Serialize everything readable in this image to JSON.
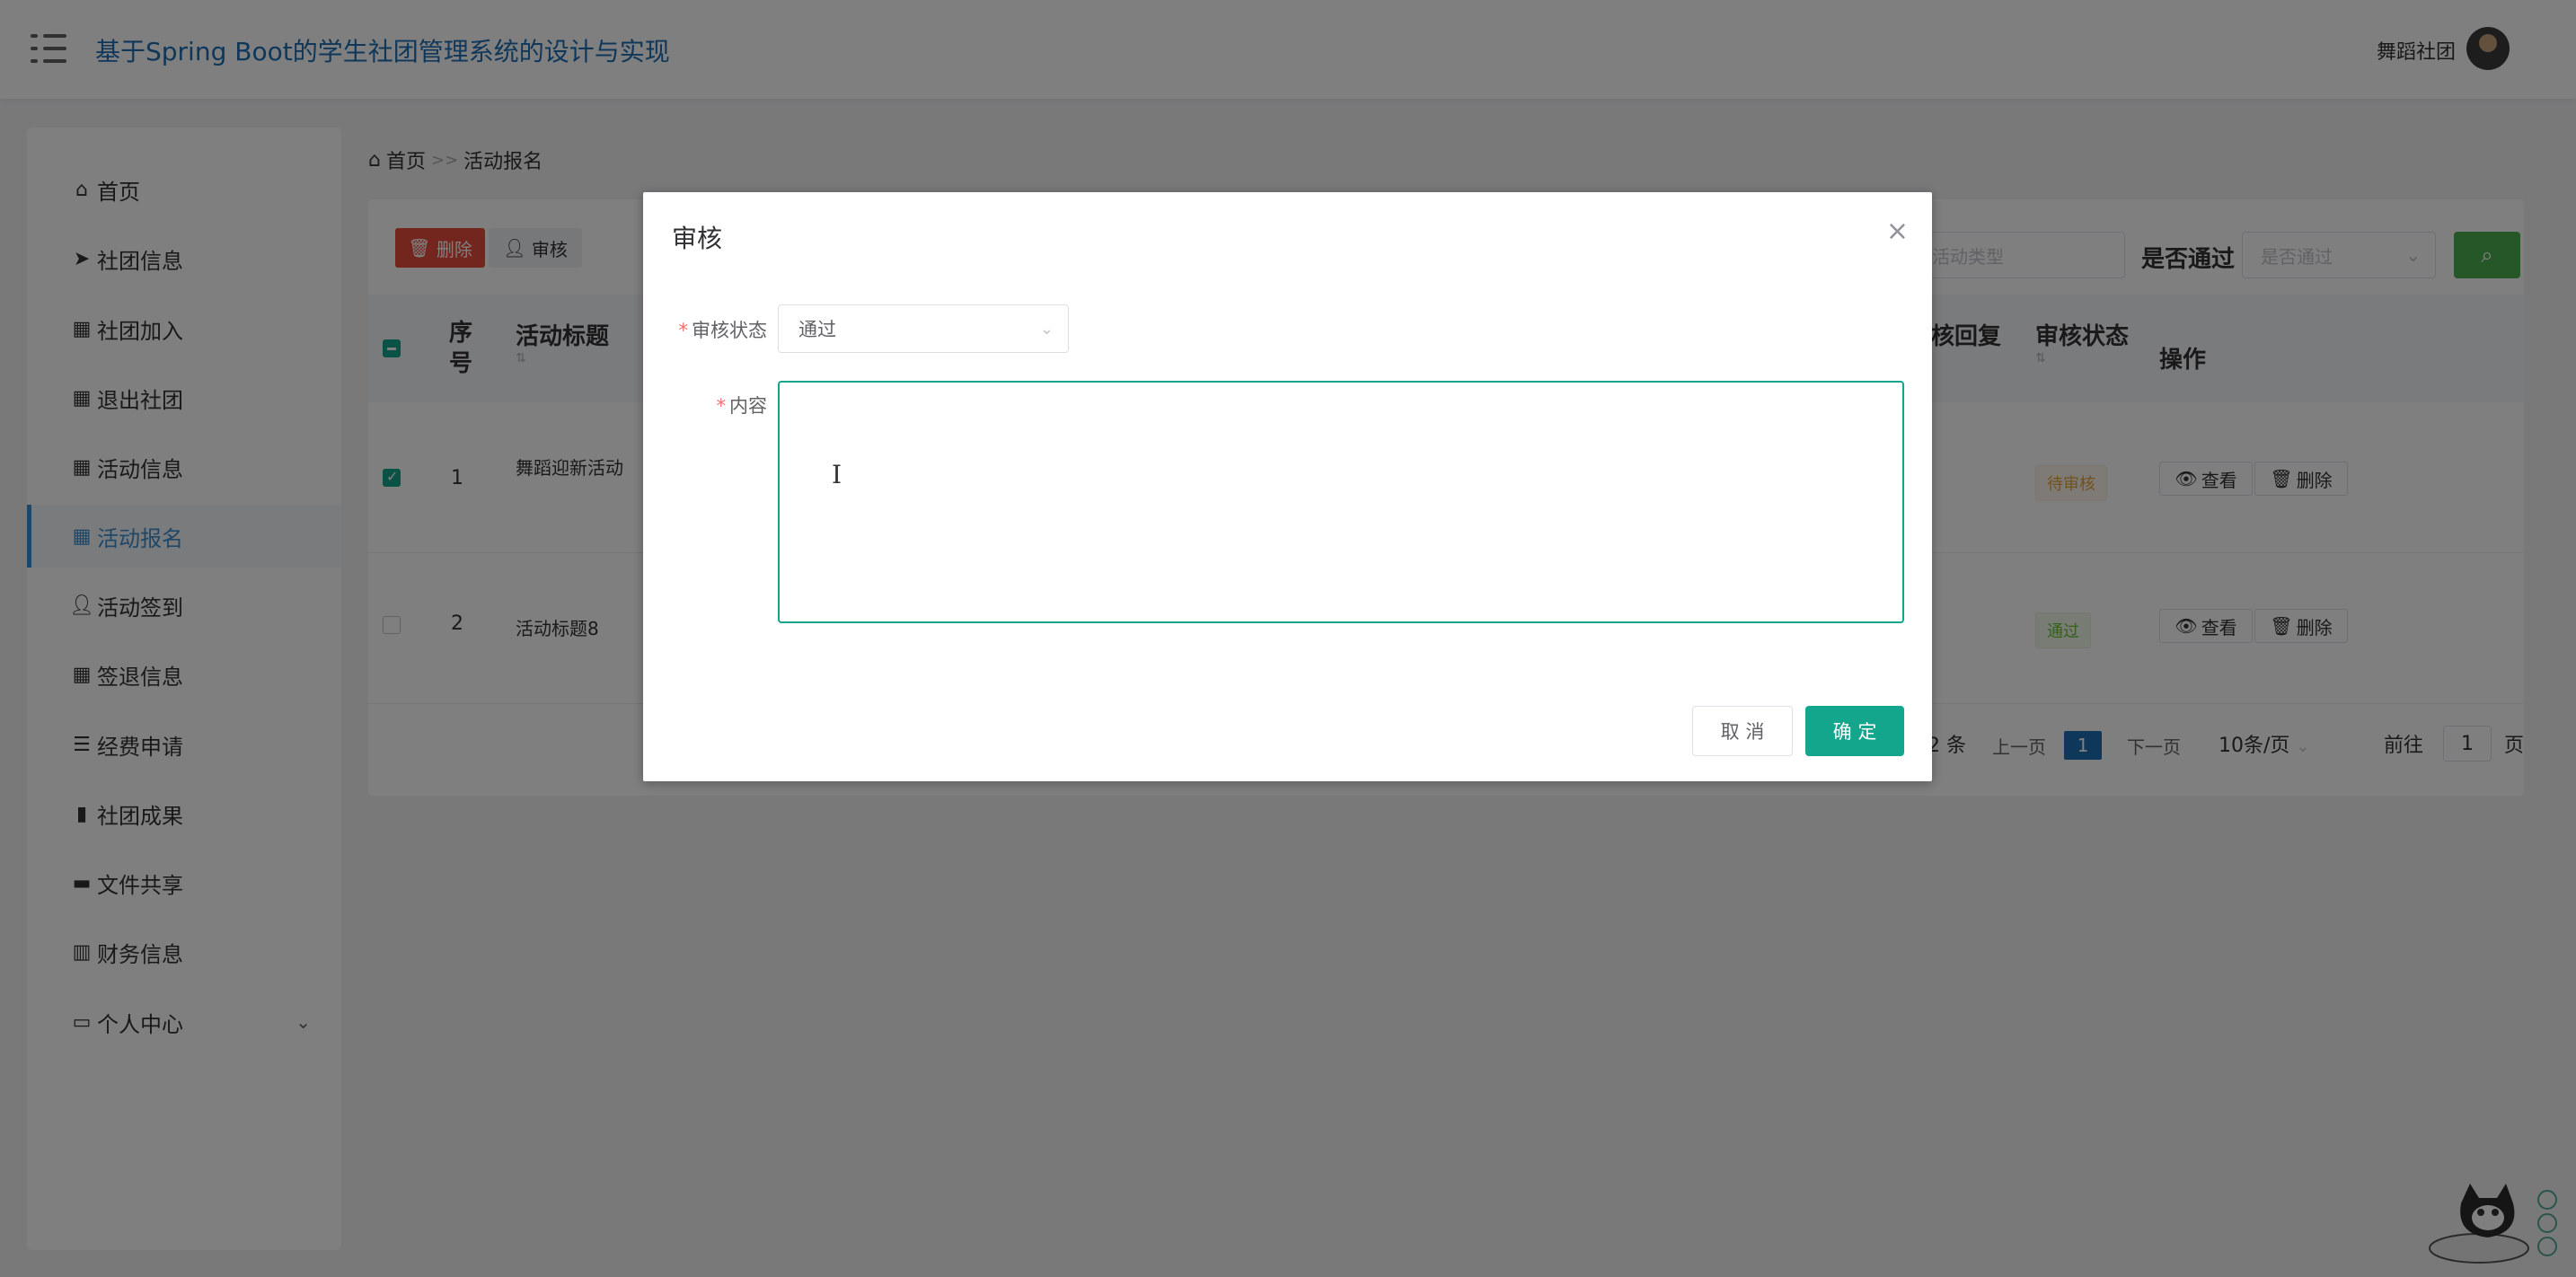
{
  "header": {
    "app_title": "基于Spring Boot的学生社团管理系统的设计与实现",
    "user_name": "舞蹈社团"
  },
  "sidebar": {
    "items": [
      {
        "label": "首页",
        "icon": "home-icon"
      },
      {
        "label": "社团信息",
        "icon": "send-icon"
      },
      {
        "label": "社团加入",
        "icon": "grid-icon"
      },
      {
        "label": "退出社团",
        "icon": "grid-icon"
      },
      {
        "label": "活动信息",
        "icon": "grid-icon"
      },
      {
        "label": "活动报名",
        "icon": "grid-icon"
      },
      {
        "label": "活动签到",
        "icon": "user-icon"
      },
      {
        "label": "签退信息",
        "icon": "grid-icon"
      },
      {
        "label": "经费申请",
        "icon": "list-icon"
      },
      {
        "label": "社团成果",
        "icon": "clipboard-icon"
      },
      {
        "label": "文件共享",
        "icon": "briefcase-icon"
      },
      {
        "label": "财务信息",
        "icon": "books-icon"
      },
      {
        "label": "个人中心",
        "icon": "card-icon"
      }
    ],
    "active": "活动报名"
  },
  "breadcrumb": {
    "home": "首页",
    "separator": ">>",
    "current": "活动报名"
  },
  "toolbar": {
    "delete_label": "删除",
    "audit_label": "审核",
    "activity_type_placeholder": "活动类型",
    "pass_label": "是否通过",
    "pass_placeholder": "是否通过"
  },
  "table": {
    "headers": {
      "index": "序号",
      "title": "活动标题",
      "reply": "核回复",
      "status": "审核状态",
      "ops": "操作"
    },
    "rows": [
      {
        "index": "1",
        "title": "舞蹈迎新活动",
        "status": "待审核",
        "checked": true
      },
      {
        "index": "2",
        "title": "活动标题8",
        "status": "通过",
        "checked": false
      }
    ],
    "view_label": "查看",
    "delete_label": "删除"
  },
  "pagination": {
    "total_text": "2 条",
    "prev": "上一页",
    "current_page": "1",
    "next": "下一页",
    "page_size": "10条/页",
    "goto_label": "前往",
    "goto_value": "1",
    "page_unit": "页"
  },
  "modal": {
    "title": "审核",
    "status_label": "审核状态",
    "status_value": "通过",
    "content_label": "内容",
    "content_value": "",
    "cancel_label": "取 消",
    "confirm_label": "确 定"
  },
  "colors": {
    "primary_teal": "#14a58d",
    "link_blue": "#1f6fb5",
    "danger_red": "#e74c3c",
    "search_green": "#4caf50"
  }
}
